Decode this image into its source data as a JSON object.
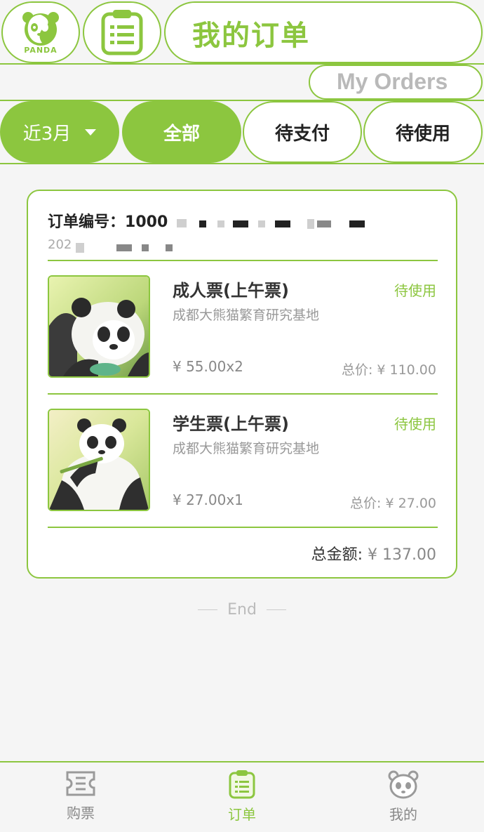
{
  "colors": {
    "accent": "#8cc63f",
    "muted": "#999999",
    "text": "#333333"
  },
  "header": {
    "logo_icon": "panda-logo-icon",
    "logo_text": "PANDA",
    "list_icon": "clipboard-list-icon",
    "title": "我的订单",
    "subtitle": "My Orders"
  },
  "filters": {
    "date_range": "近3月",
    "date_range_icon": "caret-down-icon",
    "tabs": [
      {
        "label": "全部",
        "active": true
      },
      {
        "label": "待支付",
        "active": false
      },
      {
        "label": "待使用",
        "active": false
      }
    ]
  },
  "order": {
    "number_label": "订单编号：",
    "number_visible": "1000",
    "date_visible": "202",
    "items": [
      {
        "name": "成人票(上午票)",
        "venue": "成都大熊猫繁育研究基地",
        "status": "待使用",
        "price": "¥ 55.00x2",
        "total": "总价: ¥ 110.00",
        "image": "panda-image"
      },
      {
        "name": "学生票(上午票)",
        "venue": "成都大熊猫繁育研究基地",
        "status": "待使用",
        "price": "¥ 27.00x1",
        "total": "总价: ¥ 27.00",
        "image": "panda-eating-bamboo-image"
      }
    ],
    "grand_total_label": "总金额:",
    "grand_total_value": "¥ 137.00"
  },
  "end_text": "End",
  "bottom_nav": [
    {
      "label": "购票",
      "icon": "ticket-icon",
      "active": false
    },
    {
      "label": "订单",
      "icon": "clipboard-icon",
      "active": true
    },
    {
      "label": "我的",
      "icon": "panda-face-icon",
      "active": false
    }
  ]
}
